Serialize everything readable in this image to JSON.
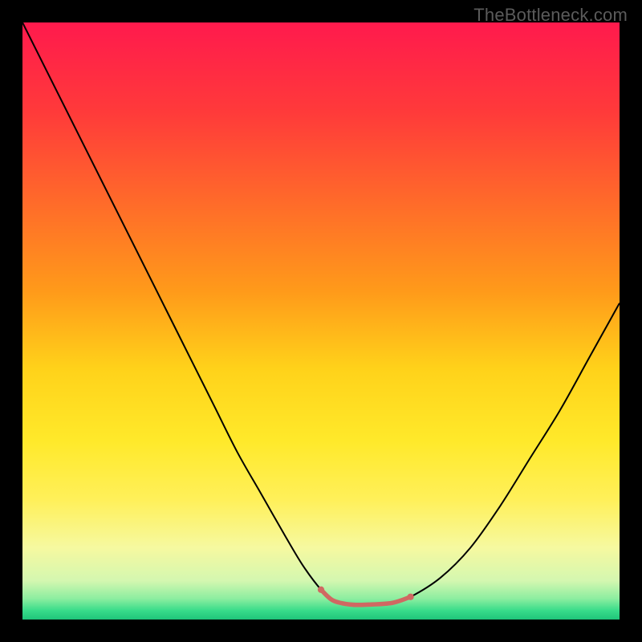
{
  "watermark": "TheBottleneck.com",
  "chart_data": {
    "type": "line",
    "title": "",
    "xlabel": "",
    "ylabel": "",
    "xlim": [
      0,
      100
    ],
    "ylim": [
      0,
      100
    ],
    "grid": false,
    "series": [
      {
        "name": "curve",
        "color": "#000000",
        "stroke_width": 2,
        "x": [
          0,
          4,
          8,
          12,
          16,
          20,
          24,
          28,
          32,
          36,
          40,
          44,
          47,
          50,
          52,
          55,
          58,
          62,
          65,
          70,
          75,
          80,
          85,
          90,
          95,
          100
        ],
        "y": [
          100,
          92,
          84,
          76,
          68,
          60,
          52,
          44,
          36,
          28,
          21,
          14,
          9,
          5,
          3.2,
          2.5,
          2.5,
          2.8,
          3.8,
          7,
          12,
          19,
          27,
          35,
          44,
          53
        ]
      },
      {
        "name": "highlight",
        "color": "#d06862",
        "stroke_width": 5.5,
        "linecap": "round",
        "x": [
          50,
          52,
          55,
          58,
          62,
          65
        ],
        "y": [
          5,
          3.2,
          2.5,
          2.5,
          2.8,
          3.8
        ]
      }
    ],
    "background_gradient": {
      "stops": [
        {
          "offset": 0.0,
          "color": "#ff1a4d"
        },
        {
          "offset": 0.15,
          "color": "#ff3a3a"
        },
        {
          "offset": 0.3,
          "color": "#ff6a2a"
        },
        {
          "offset": 0.45,
          "color": "#ff9a1a"
        },
        {
          "offset": 0.58,
          "color": "#ffd21a"
        },
        {
          "offset": 0.7,
          "color": "#ffe92a"
        },
        {
          "offset": 0.8,
          "color": "#fff05a"
        },
        {
          "offset": 0.88,
          "color": "#f6f9a0"
        },
        {
          "offset": 0.935,
          "color": "#d4f7b0"
        },
        {
          "offset": 0.965,
          "color": "#8ceea0"
        },
        {
          "offset": 0.985,
          "color": "#38dc8a"
        },
        {
          "offset": 1.0,
          "color": "#1fc47a"
        }
      ]
    }
  }
}
